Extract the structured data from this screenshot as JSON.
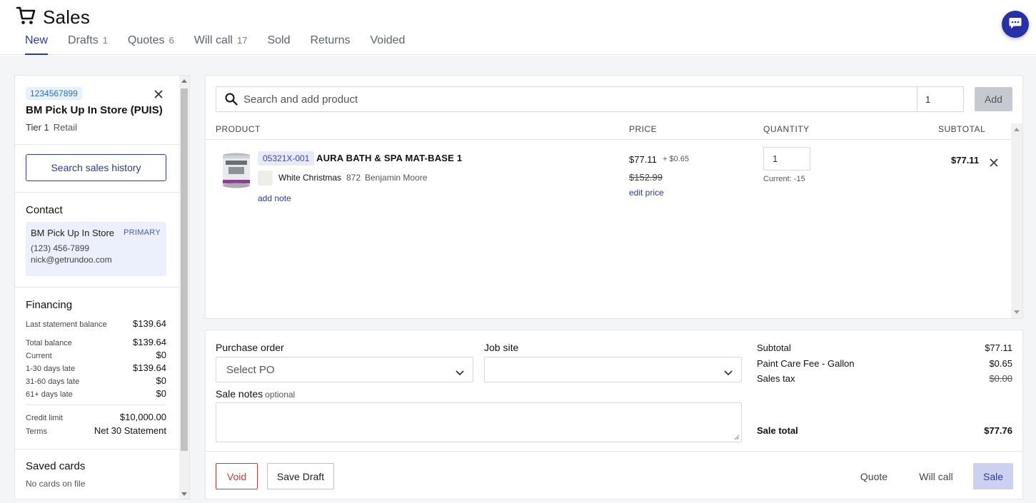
{
  "header": {
    "title": "Sales",
    "tabs": [
      {
        "label": "New",
        "count": ""
      },
      {
        "label": "Drafts",
        "count": "1"
      },
      {
        "label": "Quotes",
        "count": "6"
      },
      {
        "label": "Will call",
        "count": "17"
      },
      {
        "label": "Sold",
        "count": ""
      },
      {
        "label": "Returns",
        "count": ""
      },
      {
        "label": "Voided",
        "count": ""
      }
    ],
    "active_tab": "New"
  },
  "customer": {
    "id": "1234567899",
    "name": "BM Pick Up In Store (PUIS)",
    "tier": "Tier 1",
    "tier_type": "Retail",
    "history_button": "Search sales history"
  },
  "contact": {
    "title": "Contact",
    "name": "BM Pick Up In Store",
    "tag": "PRIMARY",
    "phone": "(123) 456-7899",
    "email": "nick@getrundoo.com"
  },
  "financing": {
    "title": "Financing",
    "rows": [
      {
        "label": "Last statement balance",
        "value": "$139.64"
      },
      {
        "label": "Total balance",
        "value": "$139.64"
      },
      {
        "label": "Current",
        "value": "$0"
      },
      {
        "label": "1-30 days late",
        "value": "$139.64"
      },
      {
        "label": "31-60 days late",
        "value": "$0"
      },
      {
        "label": "61+ days late",
        "value": "$0"
      }
    ],
    "credit_limit_label": "Credit limit",
    "credit_limit": "$10,000.00",
    "terms_label": "Terms",
    "terms": "Net 30 Statement"
  },
  "saved_cards": {
    "title": "Saved cards",
    "empty": "No cards on file"
  },
  "product_search": {
    "placeholder": "Search and add product",
    "quantity": "1",
    "add_label": "Add"
  },
  "table": {
    "headers": {
      "product": "PRODUCT",
      "price": "PRICE",
      "quantity": "QUANTITY",
      "subtotal": "SUBTOTAL"
    }
  },
  "line_item": {
    "sku": "05321X-001",
    "name": "AURA BATH & SPA MAT-BASE 1",
    "color_name": "White Christmas",
    "color_code": "872",
    "brand": "Benjamin Moore",
    "add_note": "add note",
    "price": "$77.11",
    "fee": "+ $0.65",
    "original_price": "$152.99",
    "edit_price": "edit price",
    "quantity": "1",
    "current_stock": "Current: -15",
    "subtotal": "$77.11"
  },
  "order": {
    "purchase_order_label": "Purchase order",
    "purchase_order_value": "Select PO",
    "job_site_label": "Job site",
    "job_site_value": "",
    "notes_label": "Sale notes",
    "notes_optional": "optional",
    "notes_value": ""
  },
  "summary": {
    "subtotal_label": "Subtotal",
    "subtotal": "$77.11",
    "fee_label": "Paint Care Fee - Gallon",
    "fee": "$0.65",
    "tax_label": "Sales tax",
    "tax": "$0.00",
    "total_label": "Sale total",
    "total": "$77.76"
  },
  "actions": {
    "void": "Void",
    "save_draft": "Save Draft",
    "quote": "Quote",
    "will_call": "Will call",
    "sale": "Sale"
  },
  "colors": {
    "accent": "#2b3a9b",
    "danger": "#d0393a",
    "chat": "#2630a8"
  }
}
